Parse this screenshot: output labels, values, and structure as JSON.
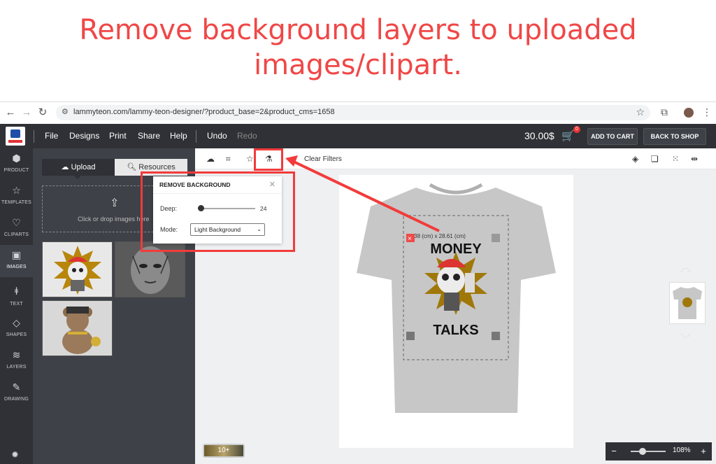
{
  "headline": {
    "line1": "Remove background layers to uploaded",
    "line2": "images/clipart."
  },
  "browser": {
    "url": "lammyteon.com/lammy-teon-designer/?product_base=2&product_cms=1658",
    "back_icon": "arrow-left-icon",
    "forward_icon": "arrow-right-icon",
    "reload_icon": "reload-icon"
  },
  "appbar": {
    "menu": [
      "File",
      "Designs",
      "Print",
      "Share",
      "Help"
    ],
    "undo": "Undo",
    "redo": "Redo",
    "price": "30.00$",
    "cart_count": "0",
    "add_to_cart": "ADD TO CART",
    "back_to_shop": "BACK TO SHOP"
  },
  "leftnav": [
    {
      "label": "PRODUCT",
      "icon": "product-icon"
    },
    {
      "label": "TEMPLATES",
      "icon": "star-icon"
    },
    {
      "label": "CLIPARTS",
      "icon": "heart-icon"
    },
    {
      "label": "IMAGES",
      "icon": "image-icon"
    },
    {
      "label": "TEXT",
      "icon": "text-icon"
    },
    {
      "label": "SHAPES",
      "icon": "diamond-icon"
    },
    {
      "label": "LAYERS",
      "icon": "layers-icon"
    },
    {
      "label": "DRAWING",
      "icon": "pencil-icon"
    }
  ],
  "panel": {
    "tab_upload": "Upload",
    "tab_resources": "Resources",
    "dropzone_text": "Click or drop images here"
  },
  "toolbar": {
    "clear_filters": "Clear Filters"
  },
  "popup": {
    "title": "REMOVE BACKGROUND",
    "deep_label": "Deep:",
    "deep_value": "24",
    "mode_label": "Mode:",
    "mode_value": "Light Background"
  },
  "design": {
    "dimensions": "25.38 (cm) x 28.61 (cm)",
    "text_top": "MONEY",
    "text_bottom": "TALKS"
  },
  "zoom": {
    "value": "108%",
    "minus": "−",
    "plus": "+"
  },
  "more_images": "10+",
  "colors": {
    "accent_red": "#f04747",
    "appbar": "#2f3136",
    "panel": "#3e4148"
  }
}
